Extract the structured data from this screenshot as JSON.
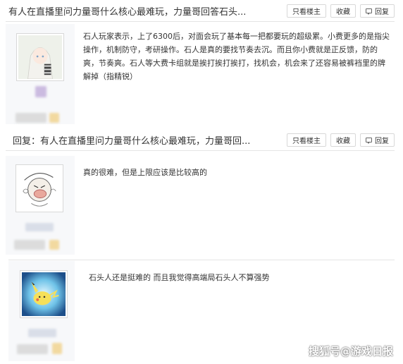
{
  "thread1": {
    "title": "有人在直播里问力量哥什么核心最难玩，力量哥回答石头...",
    "buttons": {
      "op_only": "只看楼主",
      "favorite": "收藏",
      "reply": "回复"
    }
  },
  "post1": {
    "avatar_icon": "anime-girl-white-hair-avatar",
    "text": "石人玩家表示，上了6300后，对面会玩了基本每一把都要玩的超级累。小费更多的是指尖操作，机制防守，考研操作。石人是真的要找节奏去沉。而且你小费就是正反馈，防的爽，节奏爽。石人等大费卡组就是挨打挨打挨打，找机会，机会来了还容易被裤裆里的牌解掉（指精锐）"
  },
  "thread2": {
    "title": "回复：有人在直播里问力量哥什么核心最难玩，力量哥回...",
    "buttons": {
      "op_only": "只看楼主",
      "favorite": "收藏",
      "reply": "回复"
    }
  },
  "post2": {
    "avatar_icon": "cartoon-character-sketch-avatar",
    "text": "真的很难，但是上限应该是比较高的"
  },
  "post3": {
    "avatar_icon": "pikachu-blue-glow-avatar",
    "text": "石头人还是挺难的 而且我觉得高端局石头人不算强势"
  },
  "watermark": "搜狐号@游戏日报"
}
